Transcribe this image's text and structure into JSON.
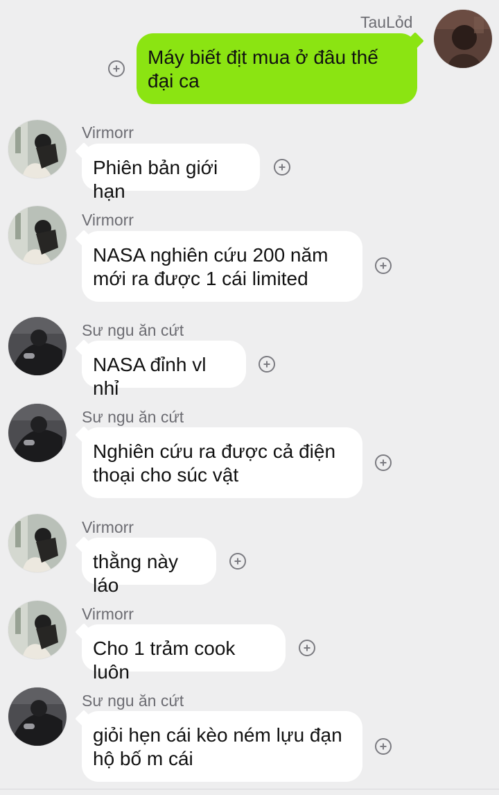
{
  "chat": {
    "messages": [
      {
        "side": "right",
        "sender": "TauLỏd",
        "text": "Máy biết địt mua ở đâu thế đại ca",
        "avatar_icon": "user-avatar-tau-lod"
      },
      {
        "side": "left",
        "sender": "Virmorr",
        "text": "Phiên bản giới hạn",
        "avatar_icon": "user-avatar-virmorr"
      },
      {
        "side": "left",
        "sender": "Virmorr",
        "text": "NASA nghiên cứu 200 năm mới ra được 1 cái limited",
        "avatar_icon": "user-avatar-virmorr"
      },
      {
        "side": "left",
        "sender": "Sư ngu ăn cứt",
        "text": "NASA đỉnh vl nhỉ",
        "avatar_icon": "user-avatar-su-ngu-an-cut"
      },
      {
        "side": "left",
        "sender": "Sư ngu ăn cứt",
        "text": "Nghiên cứu ra được cả điện thoại cho súc vật",
        "avatar_icon": "user-avatar-su-ngu-an-cut"
      },
      {
        "side": "left",
        "sender": "Virmorr",
        "text": "thằng này láo",
        "avatar_icon": "user-avatar-virmorr"
      },
      {
        "side": "left",
        "sender": "Virmorr",
        "text": "Cho 1 trảm cook luôn",
        "avatar_icon": "user-avatar-virmorr"
      },
      {
        "side": "left",
        "sender": "Sư ngu ăn cứt",
        "text": "giỏi hẹn cái kèo ném lựu đạn hộ bố m cái",
        "avatar_icon": "user-avatar-su-ngu-an-cut"
      }
    ]
  },
  "colors": {
    "background": "#eeeeef",
    "incoming_bubble": "#ffffff",
    "outgoing_bubble": "#8be412",
    "name_text": "#6c6c72",
    "message_text": "#111111",
    "react_icon": "#7a7a80"
  },
  "icons": {
    "react_button": "add-reaction-icon"
  }
}
